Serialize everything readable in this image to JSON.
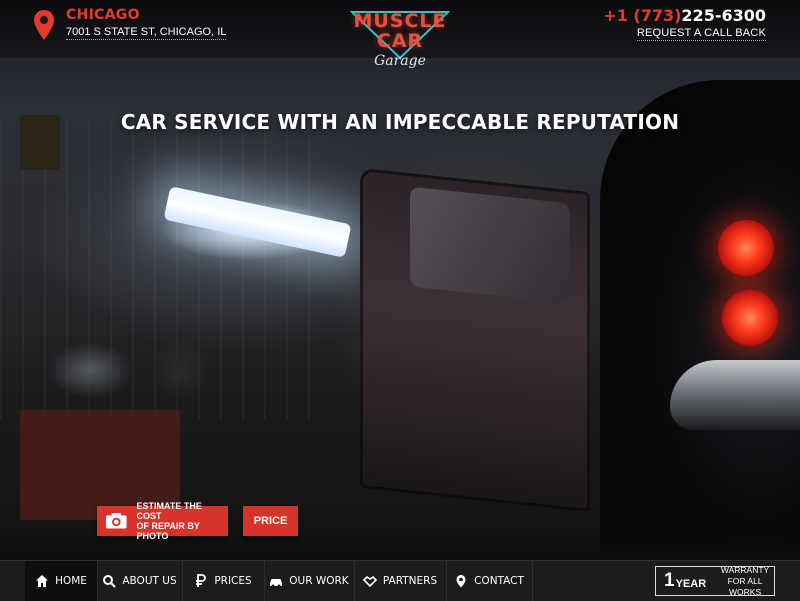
{
  "header": {
    "city": "CHICAGO",
    "address": "7001 S STATE ST, CHICAGO, IL",
    "logo": {
      "line1": "MUSCLE",
      "line2": "CAR",
      "script": "Garage"
    },
    "phone": {
      "prefix": "+1 (773)",
      "number": "225-6300"
    },
    "callback_label": "REQUEST A CALL BACK"
  },
  "hero": {
    "headline": "CAR SERVICE WITH AN IMPECCABLE REPUTATION"
  },
  "cta": {
    "estimate_line1": "ESTIMATE THE COST",
    "estimate_line2": "OF REPAIR BY PHOTO",
    "price_label": "PRICE"
  },
  "nav": {
    "items": [
      {
        "label": "HOME",
        "icon": "home-icon"
      },
      {
        "label": "ABOUT US",
        "icon": "search-icon"
      },
      {
        "label": "PRICES",
        "icon": "ruble-icon"
      },
      {
        "label": "OUR WORK",
        "icon": "car-icon"
      },
      {
        "label": "PARTNERS",
        "icon": "handshake-icon"
      },
      {
        "label": "CONTACT",
        "icon": "location-pin-icon"
      }
    ]
  },
  "warranty": {
    "number": "1",
    "unit": "YEAR",
    "line1": "WARRANTY",
    "line2": "FOR ALL WORKS"
  },
  "colors": {
    "accent": "#d8322a",
    "nav_bg": "#1c1c1e"
  }
}
